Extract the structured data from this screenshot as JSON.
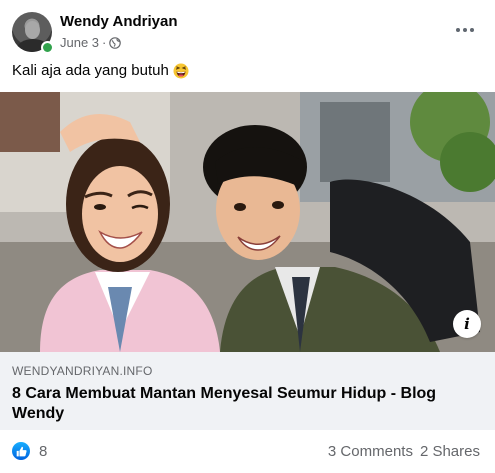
{
  "post": {
    "author": "Wendy Andriyan",
    "date": "June 3",
    "date_separator": "·",
    "privacy_icon": "globe-icon",
    "text": "Kali aja ada yang butuh",
    "emoji": "laughing-face"
  },
  "link_preview": {
    "domain": "WENDYANDRIYAN.INFO",
    "title": "8 Cara Membuat Mantan Menyesal Seumur Hidup - Blog Wendy",
    "info_label": "i"
  },
  "reactions": {
    "icon": "like-icon",
    "count": "8",
    "comments": "3 Comments",
    "shares": "2 Shares"
  },
  "colors": {
    "online": "#31a24c",
    "like_blue": "#1877f2",
    "secondary_text": "#65676b",
    "caption_bg": "#f0f2f5"
  }
}
